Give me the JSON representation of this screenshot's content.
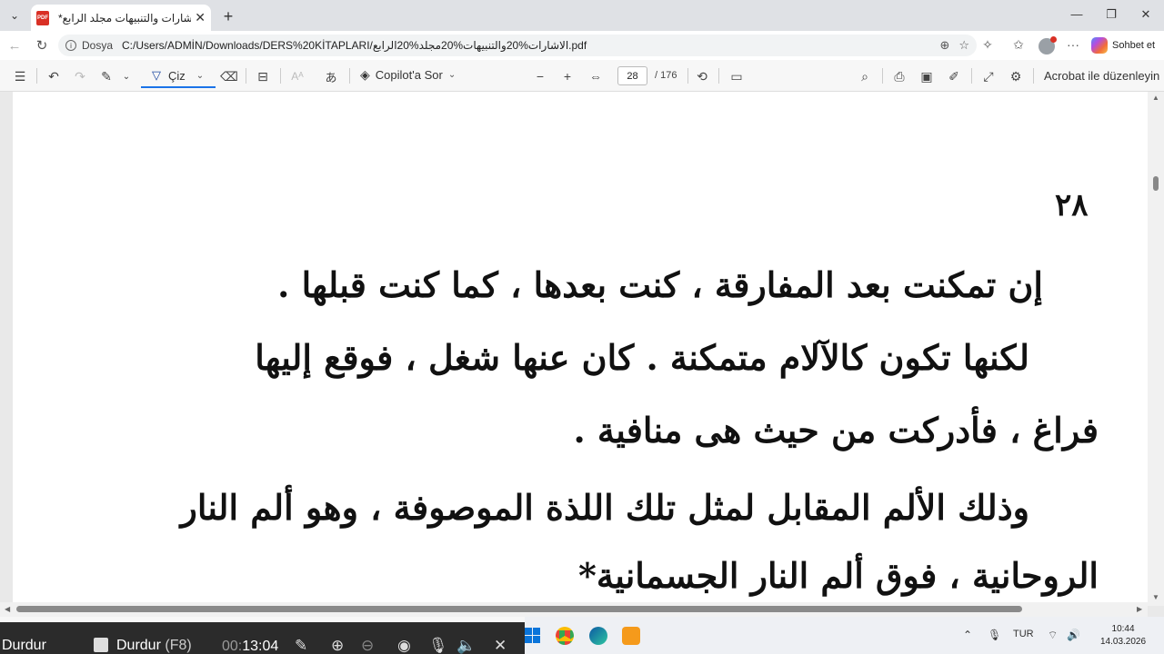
{
  "tab": {
    "title": "*الاشارات والتنبيهات مجلد الرابع.pdf",
    "close": "✕",
    "new": "+"
  },
  "window": {
    "minimize": "—",
    "maximize": "❐",
    "close": "✕"
  },
  "address": {
    "label": "Dosya",
    "url": "C:/Users/ADMİN/Downloads/DERS%20KİTAPLARI/الاشارات%20والتنبيهات%20مجلد%20الرابع.pdf",
    "copilot_label": "Sohbet et"
  },
  "toolbar": {
    "draw_label": "Çiz",
    "copilot_ask": "Copilot'a Sor",
    "page_current": "28",
    "page_total": "/ 176",
    "zoom_out": "−",
    "zoom_in": "+",
    "acrobat_label": "Acrobat ile düzenleyin"
  },
  "document": {
    "page_number": "٢٨",
    "lines": [
      "إن تمكنت بعد المفارقة ، كنت بعدها ، كما كنت قبلها .",
      "لكنها تكون كالآلام متمكنة . كان عنها شغل ، فوقع إليها",
      "فراغ ، فأدركت من حيث هى منافية .",
      "وذلك الألم المقابل لمثل تلك اللذة الموصوفة ، وهو ألم النار",
      "الروحانية ، فوق ألم النار الجسمانية*"
    ]
  },
  "recorder": {
    "stop_label_1": "Durdur",
    "stop_label_2": "Durdur",
    "stop_key": "(F8)",
    "time_prefix": "00:",
    "time": "13:04"
  },
  "taskbar": {
    "language": "TUR",
    "time": "10:44",
    "date": "14.03.2026"
  }
}
